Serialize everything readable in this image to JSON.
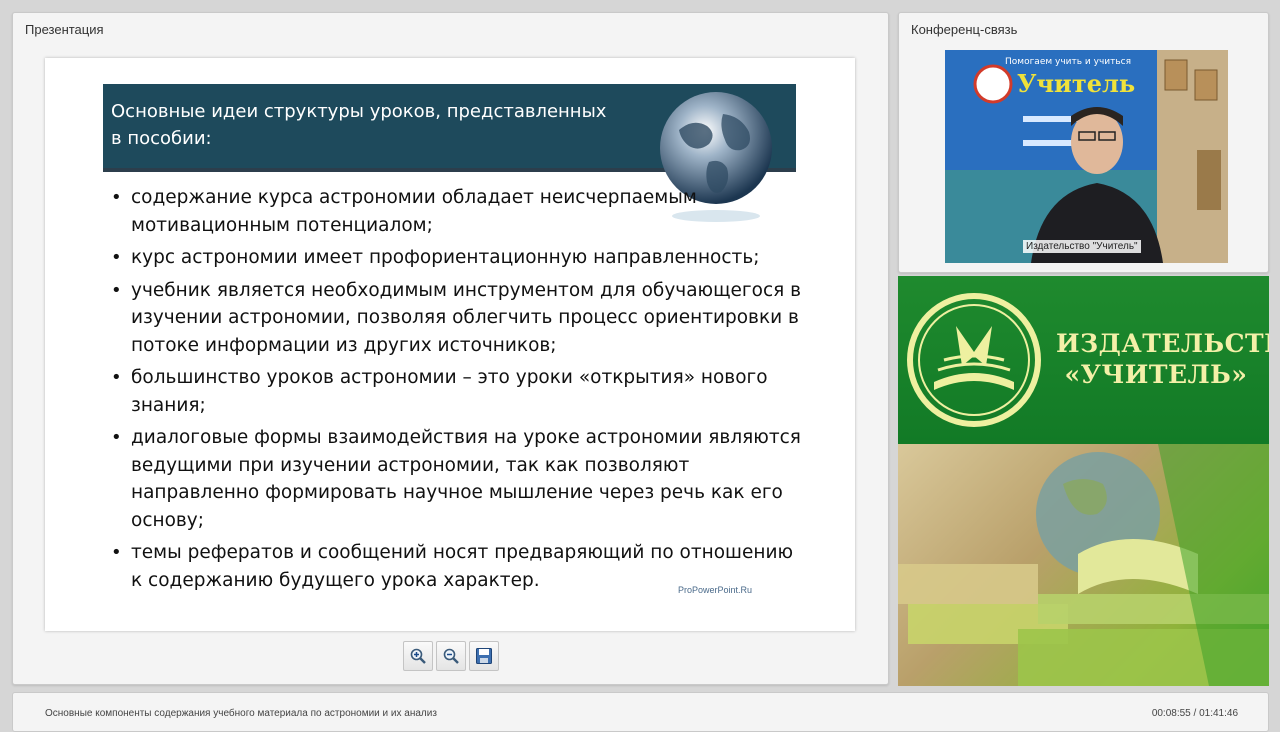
{
  "presentation": {
    "panel_title": "Презентация",
    "slide": {
      "header": "Основные идеи структуры уроков, представленных в пособии:",
      "bullets": [
        "содержание курса астрономии обладает неисчерпаемым мотивационным потенциалом;",
        "курс астрономии имеет профориентационную направленность;",
        "учебник является необходимым инструментом для обучающегося в изучении астрономии, позволяя облегчить процесс ориентировки в потоке информации из других источников;",
        "большинство уроков астрономии – это уроки «открытия» нового знания;",
        "диалоговые формы взаимодействия на уроке астрономии являются ведущими при изучении астрономии, так как позволяют направленно формировать научное мышление через речь как его основу;",
        "темы рефератов и сообщений носят предваряющий по отношению к содержанию будущего урока характер."
      ],
      "watermark": "ProPowerPoint.Ru"
    },
    "toolbar": {
      "zoom_in": "zoom-in-icon",
      "zoom_out": "zoom-out-icon",
      "save": "save-icon"
    }
  },
  "conference": {
    "panel_title": "Конференц-связь",
    "video_caption": "Издательство \"Учитель\"",
    "backdrop_text": {
      "line1": "Помогаем учить и учиться",
      "brand": "Учитель"
    }
  },
  "banner": {
    "name_line1": "ИЗДАТЕЛЬСТВО",
    "name_line2": "«УЧИТЕЛЬ»"
  },
  "footer": {
    "lecture_title": "Основные компоненты содержания учебного материала по астрономии и их анализ",
    "timecode": "00:08:55 / 01:41:46"
  },
  "colors": {
    "slide_header": "#1e4a5c",
    "banner_green": "#1f8a2e",
    "banner_text": "#f4f0a8"
  }
}
